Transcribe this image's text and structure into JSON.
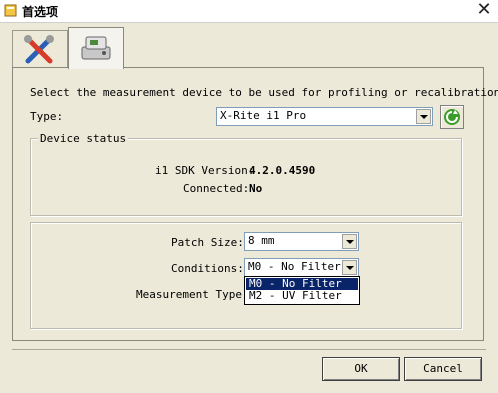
{
  "window": {
    "title": "首选项",
    "close_symbol": "✕"
  },
  "tabs": [
    {
      "name": "general",
      "icon": "tools-icon"
    },
    {
      "name": "device",
      "icon": "measurement-device-icon",
      "active": true
    }
  ],
  "instruction": "Select the measurement device to be used for profiling or recalibration:",
  "type_label": "Type:",
  "type_value": "X-Rite i1 Pro",
  "device_status": {
    "title": "Device status",
    "sdk_label": "i1 SDK Version:",
    "sdk_value": "4.2.0.4590",
    "connected_label": "Connected:",
    "connected_value": "No"
  },
  "settings": {
    "patch_size_label": "Patch Size:",
    "patch_size_value": "8 mm",
    "conditions_label": "Conditions:",
    "conditions_value": "M0 - No Filter",
    "conditions_options": [
      "M0 - No Filter",
      "M2 - UV Filter"
    ],
    "measurement_type_label": "Measurement Type:"
  },
  "buttons": {
    "ok": "OK",
    "cancel": "Cancel"
  },
  "colors": {
    "selection": "#0a246a",
    "dialog_bg": "#ece9d8",
    "refresh_green": "#3a9d2a"
  }
}
